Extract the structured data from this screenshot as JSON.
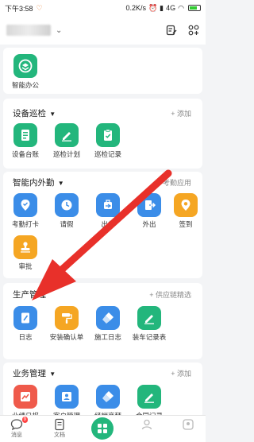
{
  "status_bar": {
    "time": "下午3:58",
    "speed": "0.2K/s",
    "network": "4G",
    "battery_level": 0.6
  },
  "header": {
    "icons": [
      "checklist-edit-icon",
      "grid-plus-icon"
    ]
  },
  "top_app": {
    "label": "智能办公"
  },
  "sections": {
    "inspection": {
      "title": "设备巡检",
      "action": "+ 添加",
      "apps": [
        "设备台账",
        "巡检计划",
        "巡检记录"
      ]
    },
    "attendance": {
      "title": "智能内外勤",
      "action": "+ 考勤应用",
      "apps": [
        "考勤打卡",
        "请假",
        "出差",
        "外出",
        "签到",
        "审批"
      ]
    },
    "production": {
      "title": "生产管理",
      "action": "+ 供应链精选",
      "apps": [
        "日志",
        "安装确认单",
        "施工日志",
        "装车记录表"
      ]
    },
    "business": {
      "title": "业务管理",
      "action": "+ 添加",
      "apps": [
        "业绩日报",
        "客户管理",
        "经销商拜",
        "合同记录"
      ]
    }
  },
  "bottom_nav": {
    "tabs": [
      "消息",
      "文档",
      "",
      "",
      ""
    ],
    "badge": "9"
  },
  "colors": {
    "green": "#23b67c",
    "blue": "#3b8de8",
    "orange": "#f5a623",
    "red": "#ef5a4b",
    "arrow": "#e8302a"
  }
}
